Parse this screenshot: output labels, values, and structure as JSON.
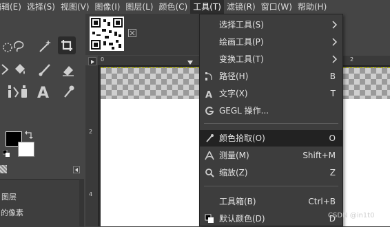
{
  "menubar": {
    "items": [
      {
        "label": "编辑(E)"
      },
      {
        "label": "选择(S)"
      },
      {
        "label": "视图(V)"
      },
      {
        "label": "图像(I)"
      },
      {
        "label": "图层(L)"
      },
      {
        "label": "颜色(C)"
      },
      {
        "label": "工具(T)",
        "active": true
      },
      {
        "label": "滤镜(R)"
      },
      {
        "label": "窗口(W)"
      },
      {
        "label": "帮助(H)"
      }
    ]
  },
  "tools_menu": {
    "items": [
      {
        "label": "选择工具(S)",
        "accel": "",
        "submenu": true,
        "icon": "none"
      },
      {
        "label": "绘画工具(P)",
        "accel": "",
        "submenu": true,
        "icon": "none"
      },
      {
        "label": "变换工具(T)",
        "accel": "",
        "submenu": true,
        "icon": "none"
      },
      {
        "label": "路径(H)",
        "accel": "B",
        "submenu": false,
        "icon": "path-icon"
      },
      {
        "label": "文字(X)",
        "accel": "T",
        "submenu": false,
        "icon": "text-tool-icon"
      },
      {
        "label": "GEGL 操作...",
        "accel": "",
        "submenu": false,
        "icon": "gegl-icon"
      },
      {
        "label": "颜色拾取(O)",
        "accel": "O",
        "submenu": false,
        "icon": "color-picker-icon",
        "highlighted": true
      },
      {
        "label": "测量(M)",
        "accel": "Shift+M",
        "submenu": false,
        "icon": "measure-icon"
      },
      {
        "label": "缩放(Z)",
        "accel": "Z",
        "submenu": false,
        "icon": "zoom-icon"
      },
      {
        "label": "工具箱(B)",
        "accel": "Ctrl+B",
        "submenu": false,
        "icon": "none"
      },
      {
        "label": "默认颜色(D)",
        "accel": "D",
        "submenu": false,
        "icon": "default-colors-icon"
      }
    ]
  },
  "rulers": {
    "h": [
      "0",
      "2"
    ],
    "v": [
      "2",
      "4"
    ]
  },
  "layers_panel": {
    "row1": "图层",
    "row2": "的像素"
  },
  "watermark": "CSDN @in1t0",
  "colors": {
    "highlight": "#222222",
    "menu_bg": "#3d3d3d",
    "app_bg": "#454545",
    "selection_outline": "#e6e600"
  }
}
